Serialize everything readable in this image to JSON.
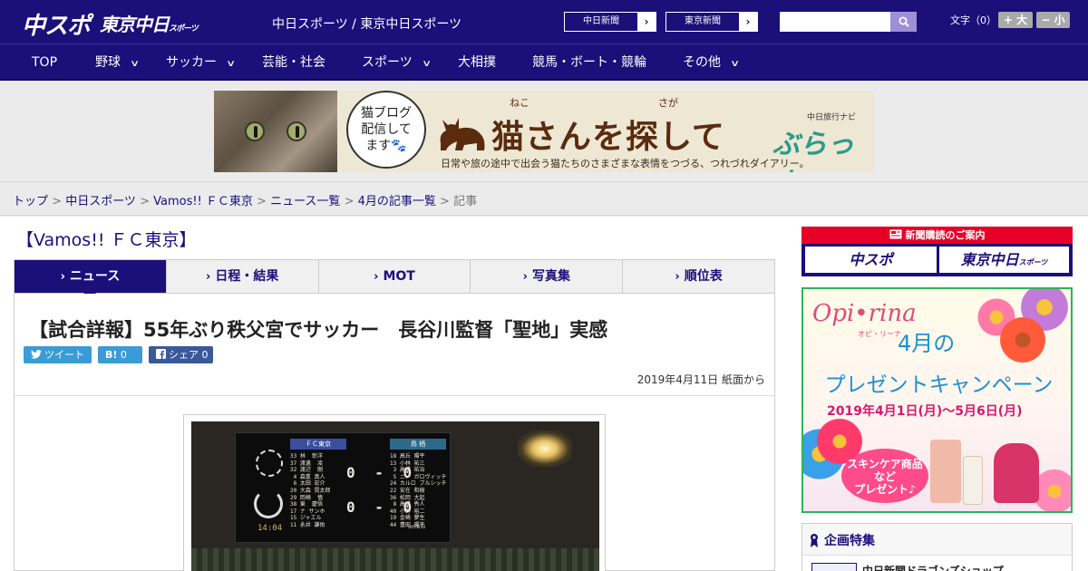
{
  "header": {
    "logo_chuspo": "中スポ",
    "logo_tokyo": "東京中日",
    "logo_tokyo_small": "スポーツ",
    "site_links": "中日スポーツ / 東京中日スポーツ",
    "chunichi_btn": "中日新聞",
    "tokyo_btn": "東京新聞",
    "arrow": "›",
    "search_placeholder": "",
    "font_size_label": "文字（0）",
    "font_plus": "+ 大",
    "font_minus": "− 小"
  },
  "nav": [
    {
      "label": "TOP",
      "has_menu": false
    },
    {
      "label": "野球",
      "has_menu": true
    },
    {
      "label": "サッカー",
      "has_menu": true
    },
    {
      "label": "芸能・社会",
      "has_menu": false
    },
    {
      "label": "スポーツ",
      "has_menu": true
    },
    {
      "label": "大相撲",
      "has_menu": false
    },
    {
      "label": "競馬・ボート・競輪",
      "has_menu": false
    },
    {
      "label": "その他",
      "has_menu": true
    }
  ],
  "nav_chevron": "∨",
  "banner": {
    "bubble_lines": [
      "猫ブログ",
      "配信して",
      "ます🐾"
    ],
    "title": "猫さんを探して",
    "ruby_neko": "ねこ",
    "ruby_saga": "さが",
    "brand_small": "中日旅行ナビ",
    "brand": "ぶらっ人",
    "subtitle": "日常や旅の途中で出会う猫たちのさまざまな表情をつづる、つれづれダイアリー。"
  },
  "breadcrumb": {
    "items": [
      "トップ",
      "中日スポーツ",
      "Vamos!! ＦＣ東京",
      "ニュース一覧",
      "4月の記事一覧"
    ],
    "current": "記事",
    "separator": " > "
  },
  "section_title": "【Vamos!! ＦＣ東京】",
  "tabs": [
    {
      "label": "ニュース",
      "active": true
    },
    {
      "label": "日程・結果",
      "active": false
    },
    {
      "label": "MOT",
      "active": false
    },
    {
      "label": "写真集",
      "active": false
    },
    {
      "label": "順位表",
      "active": false
    }
  ],
  "tab_marker": "›",
  "article": {
    "headline": "【試合詳報】55年ぶり秩父宮でサッカー　長谷川監督「聖地」実感",
    "tweet_label": "ツイート",
    "hatena_label": "B!",
    "hatena_count": "0",
    "share_label": "シェア",
    "share_count": "0",
    "date": "2019年4月11日 紙面から"
  },
  "photo": {
    "board_team_left": "ＦＣ東京",
    "board_team_right": "鳥 栖",
    "left_roster": "33 林  彰洋\n37 渡邊  凌\n32 渡辺  剛\n 4 森重 真人\n 6 太田 宏介\n20 大森 晃太郎\n29 岡崎  慎\n38 東  慶悟\n17 ナ サンホ\n15 ジャエル\n11 永井 謙佑",
    "right_roster": "18 高丘 陽平\n13 小林 祐三\n 3 高橋 祐治\n 5 ニノ ガロヴィッチ\n24 カルロ ブルシッチ\n22 安在 和樹\n36 松岡 大起\n 8 高橋 秀人\n40 小野 裕二\n19 金崎 夢生\n44 豊田 陽平",
    "score_top": "0 - 0",
    "score_bottom": "0 - 0",
    "board_time": "14:04",
    "board_brand": "umbro"
  },
  "sidebar": {
    "subs_head": "新聞購読のご案内",
    "subs_logo1": "中スポ",
    "subs_logo2": "東京中日",
    "subs_logo2_small": "スポーツ",
    "ad_logo": "Opi•rina",
    "ad_logo_sub": "オピ・リーナ",
    "ad_month": "4月の",
    "ad_campaign": "プレゼントキャンペーン",
    "ad_date": "2019年4月1日(月)〜5月6日(月)",
    "ad_bubble_lines": [
      "スキンケア商品",
      "など",
      "プレゼント♪"
    ],
    "kikaku_title": "企画特集",
    "kikaku_item": "中日新聞ドラゴンズショップ"
  },
  "colors": {
    "brand_navy": "#1b0f7a",
    "accent_red": "#e60026",
    "ad_border_green": "#2db35b"
  }
}
